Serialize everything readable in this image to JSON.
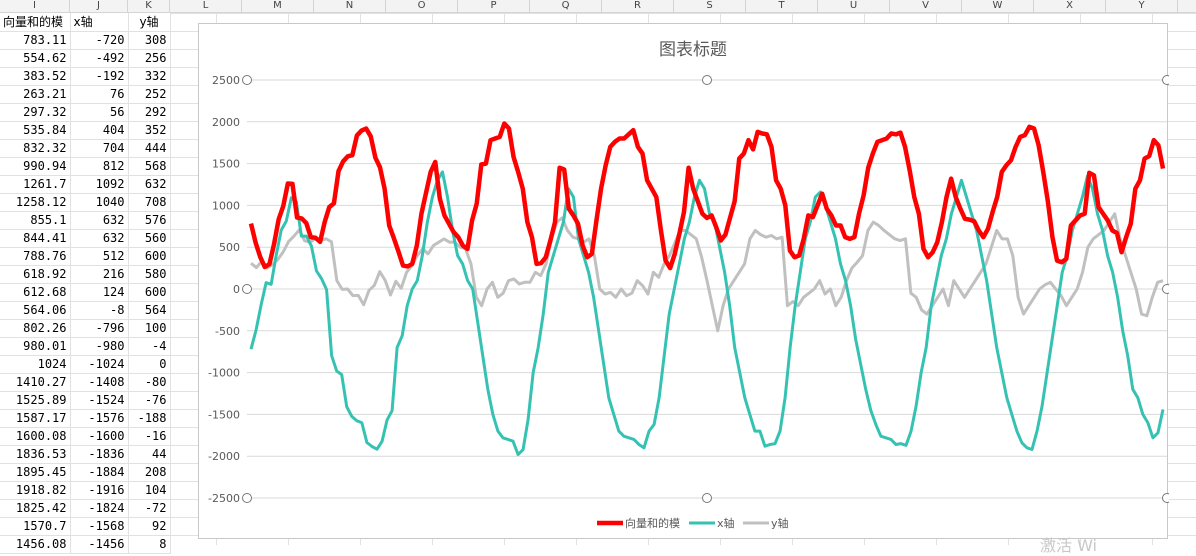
{
  "sheet": {
    "column_letters": [
      "I",
      "J",
      "K",
      "L",
      "M",
      "N",
      "O",
      "P",
      "Q",
      "R",
      "S",
      "T",
      "U",
      "V",
      "W",
      "X",
      "Y"
    ],
    "headers": {
      "magnitude": "向量和的模",
      "x": "x轴",
      "y": "y轴"
    },
    "rows": [
      [
        "783.11",
        "-720",
        "308"
      ],
      [
        "554.62",
        "-492",
        "256"
      ],
      [
        "383.52",
        "-192",
        "332"
      ],
      [
        "263.21",
        "76",
        "252"
      ],
      [
        "297.32",
        "56",
        "292"
      ],
      [
        "535.84",
        "404",
        "352"
      ],
      [
        "832.32",
        "704",
        "444"
      ],
      [
        "990.94",
        "812",
        "568"
      ],
      [
        "1261.7",
        "1092",
        "632"
      ],
      [
        "1258.12",
        "1040",
        "708"
      ],
      [
        "855.1",
        "632",
        "576"
      ],
      [
        "844.41",
        "632",
        "560"
      ],
      [
        "788.76",
        "512",
        "600"
      ],
      [
        "618.92",
        "216",
        "580"
      ],
      [
        "612.68",
        "124",
        "600"
      ],
      [
        "564.06",
        "-8",
        "564"
      ],
      [
        "802.26",
        "-796",
        "100"
      ],
      [
        "980.01",
        "-980",
        "-4"
      ],
      [
        "1024",
        "-1024",
        "0"
      ],
      [
        "1410.27",
        "-1408",
        "-80"
      ],
      [
        "1525.89",
        "-1524",
        "-76"
      ],
      [
        "1587.17",
        "-1576",
        "-188"
      ],
      [
        "1600.08",
        "-1600",
        "-16"
      ],
      [
        "1836.53",
        "-1836",
        "44"
      ],
      [
        "1895.45",
        "-1884",
        "208"
      ],
      [
        "1918.82",
        "-1916",
        "104"
      ],
      [
        "1825.42",
        "-1824",
        "-72"
      ],
      [
        "1570.7",
        "-1568",
        "92"
      ],
      [
        "1456.08",
        "-1456",
        "8"
      ]
    ]
  },
  "watermark": "激活 Wi",
  "chart_data": {
    "type": "line",
    "title": "图表标题",
    "xlabel": "",
    "ylabel": "",
    "ylim": [
      -2500,
      2500
    ],
    "yticks": [
      2500,
      2000,
      1500,
      1000,
      500,
      0,
      -500,
      -1000,
      -1500,
      -2000,
      -2500
    ],
    "grid": true,
    "legend_position": "bottom",
    "series": [
      {
        "name": "向量和的模",
        "color": "#ff0000",
        "values": [
          783,
          555,
          384,
          263,
          297,
          536,
          832,
          991,
          1262,
          1258,
          855,
          844,
          789,
          619,
          613,
          564,
          802,
          980,
          1024,
          1410,
          1526,
          1587,
          1600,
          1837,
          1895,
          1919,
          1825,
          1571,
          1456,
          1200,
          760,
          610,
          450,
          280,
          270,
          300,
          520,
          900,
          1150,
          1400,
          1520,
          1080,
          880,
          780,
          680,
          620,
          520,
          480,
          820,
          1020,
          1490,
          1500,
          1780,
          1800,
          1820,
          1980,
          1920,
          1580,
          1400,
          1200,
          800,
          620,
          300,
          310,
          380,
          580,
          800,
          1450,
          1430,
          960,
          880,
          780,
          520,
          380,
          420,
          820,
          1200,
          1480,
          1700,
          1760,
          1800,
          1800,
          1850,
          1900,
          1700,
          1620,
          1300,
          1200,
          1100,
          700,
          340,
          250,
          420,
          660,
          920,
          1450,
          1200,
          1050,
          900,
          850,
          880,
          740,
          580,
          650,
          850,
          1050,
          1560,
          1620,
          1780,
          1670,
          1880,
          1860,
          1850,
          1700,
          1300,
          1200,
          1000,
          460,
          380,
          400,
          600,
          880,
          860,
          1000,
          1140,
          960,
          880,
          760,
          760,
          620,
          600,
          620,
          900,
          1120,
          1450,
          1620,
          1760,
          1780,
          1800,
          1860,
          1850,
          1870,
          1700,
          1420,
          1100,
          900,
          480,
          380,
          440,
          560,
          800,
          1100,
          1320,
          1100,
          960,
          840,
          830,
          810,
          700,
          620,
          720,
          920,
          1100,
          1400,
          1480,
          1540,
          1700,
          1820,
          1840,
          1940,
          1920,
          1720,
          1400,
          1050,
          620,
          340,
          320,
          360,
          760,
          820,
          880,
          900,
          1390,
          1360,
          980,
          900,
          820,
          700,
          670,
          440,
          620,
          780,
          1200,
          1300,
          1560,
          1590,
          1780,
          1720,
          1440
        ]
      },
      {
        "name": "x轴",
        "color": "#35c2b3",
        "values": [
          -720,
          -492,
          -192,
          76,
          56,
          404,
          704,
          812,
          1092,
          1040,
          632,
          632,
          512,
          216,
          124,
          -8,
          -796,
          -980,
          -1024,
          -1408,
          -1524,
          -1576,
          -1600,
          -1836,
          -1884,
          -1916,
          -1824,
          -1568,
          -1456,
          -700,
          -560,
          -200,
          0,
          100,
          400,
          800,
          1100,
          1300,
          1400,
          1100,
          700,
          400,
          300,
          100,
          0,
          -400,
          -800,
          -1200,
          -1500,
          -1700,
          -1780,
          -1800,
          -1820,
          -1980,
          -1920,
          -1560,
          -1000,
          -700,
          -300,
          200,
          400,
          600,
          800,
          1200,
          1100,
          600,
          400,
          200,
          -100,
          -500,
          -900,
          -1300,
          -1500,
          -1700,
          -1760,
          -1780,
          -1800,
          -1860,
          -1900,
          -1700,
          -1620,
          -1300,
          -800,
          -300,
          0,
          300,
          600,
          800,
          1100,
          1300,
          1200,
          900,
          800,
          500,
          200,
          -200,
          -700,
          -1000,
          -1300,
          -1500,
          -1700,
          -1700,
          -1880,
          -1860,
          -1850,
          -1700,
          -1300,
          -700,
          -200,
          200,
          600,
          800,
          1100,
          1160,
          1000,
          800,
          600,
          300,
          100,
          -200,
          -600,
          -900,
          -1200,
          -1450,
          -1620,
          -1760,
          -1780,
          -1800,
          -1860,
          -1850,
          -1870,
          -1700,
          -1400,
          -1000,
          -700,
          -200,
          100,
          400,
          600,
          900,
          1100,
          1300,
          1100,
          900,
          700,
          400,
          100,
          -300,
          -700,
          -1000,
          -1300,
          -1500,
          -1700,
          -1840,
          -1900,
          -1920,
          -1700,
          -1400,
          -1000,
          -600,
          -200,
          200,
          400,
          700,
          900,
          1100,
          1350,
          1200,
          900,
          700,
          400,
          200,
          -100,
          -500,
          -800,
          -1200,
          -1300,
          -1500,
          -1600,
          -1780,
          -1720,
          -1440
        ]
      },
      {
        "name": "y轴",
        "color": "#c0c0c0",
        "values": [
          308,
          256,
          332,
          252,
          292,
          352,
          444,
          568,
          632,
          708,
          576,
          560,
          600,
          580,
          600,
          564,
          100,
          -4,
          0,
          -80,
          -76,
          -188,
          -16,
          44,
          208,
          104,
          -72,
          92,
          8,
          200,
          280,
          400,
          480,
          420,
          520,
          560,
          600,
          560,
          560,
          500,
          480,
          300,
          -100,
          -200,
          0,
          80,
          -100,
          -50,
          100,
          120,
          60,
          80,
          80,
          200,
          160,
          300,
          600,
          800,
          850,
          700,
          620,
          600,
          560,
          600,
          400,
          0,
          -60,
          -40,
          -100,
          0,
          -80,
          -50,
          100,
          40,
          -60,
          200,
          140,
          300,
          400,
          550,
          700,
          700,
          650,
          600,
          380,
          100,
          -200,
          -500,
          -200,
          0,
          100,
          200,
          300,
          600,
          700,
          650,
          620,
          640,
          600,
          620,
          -200,
          -150,
          -200,
          -100,
          -50,
          0,
          100,
          -60,
          0,
          -200,
          -100,
          100,
          250,
          320,
          400,
          700,
          800,
          760,
          700,
          650,
          600,
          580,
          600,
          -50,
          -100,
          -250,
          -300,
          -200,
          -100,
          0,
          -200,
          100,
          0,
          -100,
          0,
          100,
          200,
          300,
          500,
          700,
          600,
          600,
          400,
          -100,
          -300,
          -200,
          -100,
          0,
          50,
          80,
          0,
          -80,
          -200,
          -100,
          0,
          200,
          500,
          600,
          650,
          700,
          800,
          900,
          600,
          400,
          200,
          0,
          -300,
          -320,
          -100,
          80,
          100
        ]
      }
    ]
  }
}
